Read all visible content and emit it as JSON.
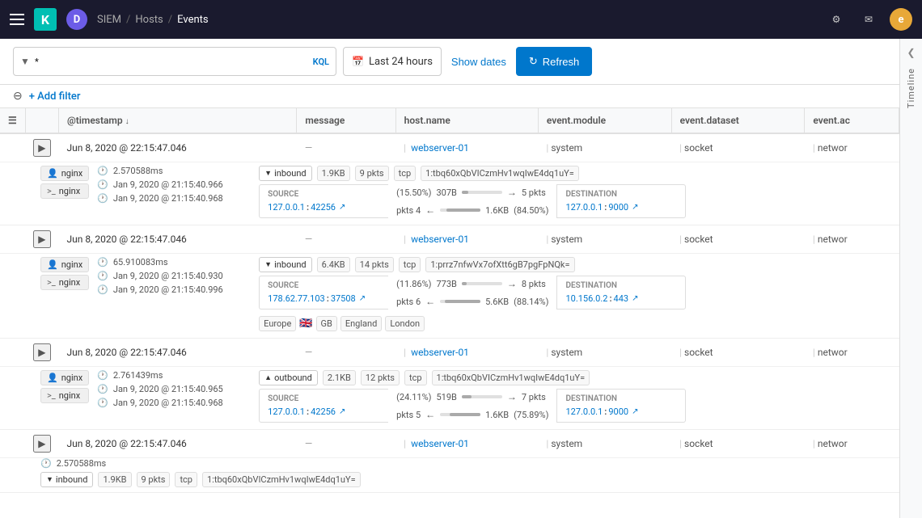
{
  "nav": {
    "hamburger_label": "Menu",
    "logo_k": "K",
    "logo_d": "D",
    "breadcrumb": [
      "SIEM",
      "Hosts",
      "Events"
    ],
    "nav_icons": [
      "settings-icon",
      "mail-icon"
    ],
    "user_initial": "e"
  },
  "toolbar": {
    "query_value": "*",
    "kql_label": "KQL",
    "calendar_icon": "📅",
    "time_range": "Last 24 hours",
    "show_dates_label": "Show dates",
    "refresh_label": "Refresh"
  },
  "filter_bar": {
    "add_filter_label": "+ Add filter"
  },
  "table": {
    "columns": [
      "@timestamp",
      "message",
      "host.name",
      "event.module",
      "event.dataset",
      "event.ac"
    ],
    "rows": [
      {
        "id": "row1",
        "timestamp": "Jun 8, 2020 @ 22:15:47.046",
        "message": "—",
        "host": "webserver-01",
        "module": "system",
        "dataset": "socket",
        "event_ac": "networ",
        "expanded": true,
        "detail": {
          "badges": [
            "nginx",
            ">_ nginx"
          ],
          "times": [
            "2.570588ms",
            "Jan 9, 2020 @ 21:15:40.966",
            "Jan 9, 2020 @ 21:15:40.968"
          ],
          "direction": "inbound",
          "size": "1.9KB",
          "pkts": "9 pkts",
          "proto": "tcp",
          "flow_id": "1:tbq60xQbVICzmHv1wqIwE4dq1uY=",
          "src_ip": "127.0.0.1",
          "src_port": "42256",
          "dst_ip": "127.0.0.1",
          "dst_port": "9000",
          "stat1_pct": "15.50%",
          "stat1_bytes": "307B",
          "stat1_pkts": "5 pkts",
          "stat2_pct": "84.50%",
          "stat2_bytes": "1.6KB",
          "stat2_pkts": "4 pkts",
          "geo": []
        }
      },
      {
        "id": "row2",
        "timestamp": "Jun 8, 2020 @ 22:15:47.046",
        "message": "—",
        "host": "webserver-01",
        "module": "system",
        "dataset": "socket",
        "event_ac": "networ",
        "expanded": true,
        "detail": {
          "badges": [
            "nginx",
            ">_ nginx"
          ],
          "times": [
            "65.910083ms",
            "Jan 9, 2020 @ 21:15:40.930",
            "Jan 9, 2020 @ 21:15:40.996"
          ],
          "direction": "inbound",
          "size": "6.4KB",
          "pkts": "14 pkts",
          "proto": "tcp",
          "flow_id": "1:prrz7nfwVx7ofXtt6gB7pgFpNQk=",
          "src_ip": "178.62.77.103",
          "src_port": "37508",
          "dst_ip": "10.156.0.2",
          "dst_port": "443",
          "stat1_pct": "11.86%",
          "stat1_bytes": "773B",
          "stat1_pkts": "8 pkts",
          "stat2_pct": "88.14%",
          "stat2_bytes": "5.6KB",
          "stat2_pkts": "6 pkts",
          "geo": [
            "Europe",
            "GB",
            "England",
            "London"
          ]
        }
      },
      {
        "id": "row3",
        "timestamp": "Jun 8, 2020 @ 22:15:47.046",
        "message": "—",
        "host": "webserver-01",
        "module": "system",
        "dataset": "socket",
        "event_ac": "networ",
        "expanded": true,
        "detail": {
          "badges": [
            "nginx",
            ">_ nginx"
          ],
          "times": [
            "2.761439ms",
            "Jan 9, 2020 @ 21:15:40.965",
            "Jan 9, 2020 @ 21:15:40.968"
          ],
          "direction": "outbound",
          "size": "2.1KB",
          "pkts": "12 pkts",
          "proto": "tcp",
          "flow_id": "1:tbq60xQbVICzmHv1wqIwE4dq1uY=",
          "src_ip": "127.0.0.1",
          "src_port": "42256",
          "dst_ip": "127.0.0.1",
          "dst_port": "9000",
          "stat1_pct": "24.11%",
          "stat1_bytes": "519B",
          "stat1_pkts": "7 pkts",
          "stat2_pct": "75.89%",
          "stat2_bytes": "1.6KB",
          "stat2_pkts": "5 pkts",
          "geo": []
        }
      },
      {
        "id": "row4",
        "timestamp": "Jun 8, 2020 @ 22:15:47.046",
        "message": "—",
        "host": "webserver-01",
        "module": "system",
        "dataset": "socket",
        "event_ac": "networ",
        "expanded": false,
        "detail": {
          "badges": [],
          "times": [
            "2.570588ms"
          ],
          "direction": "inbound",
          "size": "1.9KB",
          "pkts": "9 pkts",
          "proto": "tcp",
          "flow_id": "1:tbq60xQbVICzmHv1wqIwE4dq1uY=",
          "src_ip": "",
          "src_port": "",
          "dst_ip": "",
          "dst_port": "",
          "stat1_pct": "",
          "stat1_bytes": "",
          "stat1_pkts": "",
          "stat2_pct": "",
          "stat2_bytes": "",
          "stat2_pkts": "",
          "geo": []
        }
      }
    ]
  },
  "timeline": {
    "label": "Timeline",
    "chevron": "❮"
  }
}
